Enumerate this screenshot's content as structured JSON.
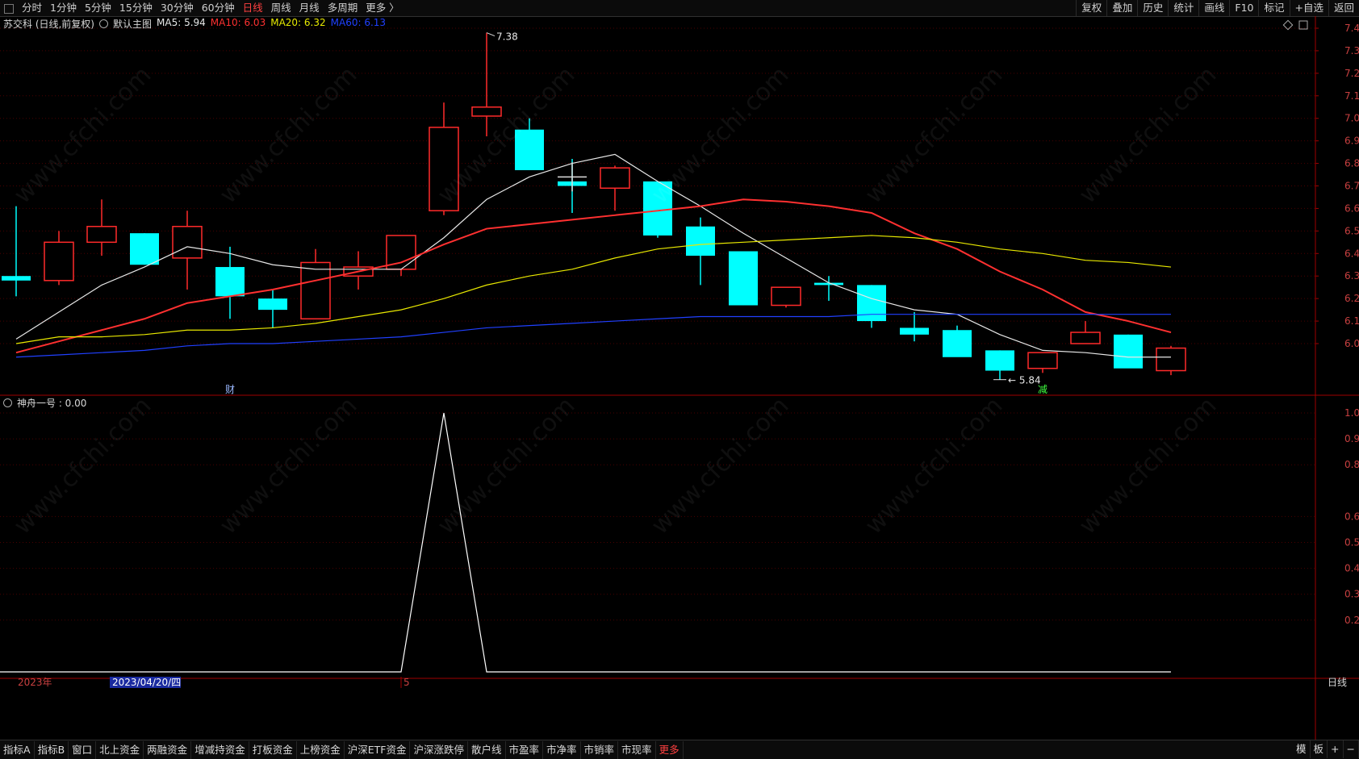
{
  "toolbar": {
    "periods": [
      {
        "label": "分时",
        "active": false
      },
      {
        "label": "1分钟",
        "active": false
      },
      {
        "label": "5分钟",
        "active": false
      },
      {
        "label": "15分钟",
        "active": false
      },
      {
        "label": "30分钟",
        "active": false
      },
      {
        "label": "60分钟",
        "active": false
      },
      {
        "label": "日线",
        "active": true
      },
      {
        "label": "周线",
        "active": false
      },
      {
        "label": "月线",
        "active": false
      },
      {
        "label": "多周期",
        "active": false
      },
      {
        "label": "更多 〉",
        "active": false
      }
    ],
    "right_buttons": [
      "复权",
      "叠加",
      "历史",
      "统计",
      "画线",
      "F10",
      "标记",
      "+自选",
      "返回"
    ]
  },
  "main_chart": {
    "stock_label": "苏交科 (日线,前复权)",
    "template_label": "默认主图",
    "ma_legend": [
      {
        "text": "MA5: 5.94",
        "color": "#e8e8e8"
      },
      {
        "text": "MA10: 6.03",
        "color": "#ff3030"
      },
      {
        "text": "MA20: 6.32",
        "color": "#e8e800"
      },
      {
        "text": "MA60: 6.13",
        "color": "#2040ff"
      }
    ],
    "y_axis_labels": [
      "7.40",
      "7.30",
      "7.20",
      "7.10",
      "7.00",
      "6.90",
      "6.80",
      "6.70",
      "6.60",
      "6.50",
      "6.40",
      "6.30",
      "6.20",
      "6.10",
      "6.00"
    ],
    "high_label": "7.38",
    "low_label": "5.84",
    "markers": [
      {
        "text": "财",
        "color": "#9ab8ff"
      },
      {
        "text": "减",
        "color": "#40ff40"
      }
    ]
  },
  "chart_data": [
    {
      "type": "candlestick",
      "title": "苏交科 (日线,前复权)",
      "ylim": [
        5.8,
        7.45
      ],
      "ohlc": [
        [
          6.3,
          6.61,
          6.21,
          6.28
        ],
        [
          6.28,
          6.5,
          6.26,
          6.45
        ],
        [
          6.45,
          6.64,
          6.39,
          6.52
        ],
        [
          6.49,
          6.49,
          6.35,
          6.35
        ],
        [
          6.38,
          6.59,
          6.24,
          6.52
        ],
        [
          6.34,
          6.43,
          6.11,
          6.21
        ],
        [
          6.2,
          6.24,
          6.07,
          6.15
        ],
        [
          6.11,
          6.42,
          6.11,
          6.36
        ],
        [
          6.3,
          6.41,
          6.24,
          6.34
        ],
        [
          6.33,
          6.48,
          6.3,
          6.48
        ],
        [
          6.59,
          7.07,
          6.57,
          6.96
        ],
        [
          7.01,
          7.38,
          6.92,
          7.05
        ],
        [
          6.95,
          7.0,
          6.77,
          6.77
        ],
        [
          6.72,
          6.82,
          6.58,
          6.7
        ],
        [
          6.69,
          6.79,
          6.59,
          6.78
        ],
        [
          6.72,
          6.72,
          6.47,
          6.48
        ],
        [
          6.52,
          6.56,
          6.26,
          6.39
        ],
        [
          6.41,
          6.41,
          6.17,
          6.17
        ],
        [
          6.17,
          6.25,
          6.16,
          6.25
        ],
        [
          6.27,
          6.3,
          6.19,
          6.26
        ],
        [
          6.26,
          6.26,
          6.07,
          6.1
        ],
        [
          6.07,
          6.14,
          6.01,
          6.04
        ],
        [
          6.06,
          6.08,
          5.95,
          5.94
        ],
        [
          5.97,
          5.97,
          5.84,
          5.88
        ],
        [
          5.89,
          5.96,
          5.87,
          5.96
        ],
        [
          6.0,
          6.1,
          6.0,
          6.05
        ],
        [
          6.04,
          6.04,
          5.91,
          5.89
        ],
        [
          5.88,
          5.99,
          5.86,
          5.98
        ]
      ],
      "series": [
        {
          "name": "MA5",
          "color": "#e8e8e8",
          "values": [
            6.02,
            6.14,
            6.26,
            6.34,
            6.43,
            6.4,
            6.35,
            6.33,
            6.33,
            6.33,
            6.47,
            6.64,
            6.74,
            6.8,
            6.84,
            6.72,
            6.61,
            6.49,
            6.38,
            6.27,
            6.2,
            6.15,
            6.13,
            6.04,
            5.97,
            5.96,
            5.94,
            5.94
          ]
        },
        {
          "name": "MA10",
          "color": "#ff3030",
          "values": [
            5.96,
            6.01,
            6.06,
            6.11,
            6.18,
            6.21,
            6.24,
            6.28,
            6.32,
            6.36,
            6.44,
            6.51,
            6.53,
            6.55,
            6.57,
            6.59,
            6.61,
            6.64,
            6.63,
            6.61,
            6.58,
            6.49,
            6.42,
            6.32,
            6.24,
            6.14,
            6.1,
            6.05
          ]
        },
        {
          "name": "MA20",
          "color": "#e8e800",
          "values": [
            6.0,
            6.03,
            6.03,
            6.04,
            6.06,
            6.06,
            6.07,
            6.09,
            6.12,
            6.15,
            6.2,
            6.26,
            6.3,
            6.33,
            6.38,
            6.42,
            6.44,
            6.45,
            6.46,
            6.47,
            6.48,
            6.47,
            6.45,
            6.42,
            6.4,
            6.37,
            6.36,
            6.34
          ]
        },
        {
          "name": "MA60",
          "color": "#2040ff",
          "values": [
            5.94,
            5.95,
            5.96,
            5.97,
            5.99,
            6.0,
            6.0,
            6.01,
            6.02,
            6.03,
            6.05,
            6.07,
            6.08,
            6.09,
            6.1,
            6.11,
            6.12,
            6.12,
            6.12,
            6.12,
            6.13,
            6.13,
            6.13,
            6.13,
            6.13,
            6.13,
            6.13,
            6.13
          ]
        }
      ]
    },
    {
      "type": "line",
      "title": "神舟一号 : 0.00",
      "ylim": [
        0,
        1.05
      ],
      "series": [
        {
          "name": "神舟一号",
          "color": "#ffffff",
          "values": [
            0,
            0,
            0,
            0,
            0,
            0,
            0,
            0,
            0,
            0,
            1,
            0,
            0,
            0,
            0,
            0,
            0,
            0,
            0,
            0,
            0,
            0,
            0,
            0,
            0,
            0,
            0,
            0
          ]
        }
      ]
    }
  ],
  "indicator": {
    "label": "神舟一号 : 0.00",
    "y_axis_labels": [
      "1.00",
      "0.90",
      "0.80",
      "0.60",
      "0.50",
      "0.40",
      "0.30",
      "0.20"
    ]
  },
  "date_axis": {
    "year_label": "2023年",
    "cursor_date": "2023/04/20/四",
    "month_mark": "5",
    "period_label": "日线"
  },
  "bottom_tabs": [
    {
      "label": "指标A",
      "active": false
    },
    {
      "label": "指标B",
      "active": false
    },
    {
      "label": "窗口",
      "active": false
    },
    {
      "label": "北上资金",
      "active": false
    },
    {
      "label": "两融资金",
      "active": false
    },
    {
      "label": "增减持资金",
      "active": false
    },
    {
      "label": "打板资金",
      "active": false
    },
    {
      "label": "上榜资金",
      "active": false
    },
    {
      "label": "沪深ETF资金",
      "active": false
    },
    {
      "label": "沪深涨跌停",
      "active": false
    },
    {
      "label": "散户线",
      "active": false
    },
    {
      "label": "市盈率",
      "active": false
    },
    {
      "label": "市净率",
      "active": false
    },
    {
      "label": "市销率",
      "active": false
    },
    {
      "label": "市现率",
      "active": false
    },
    {
      "label": "更多",
      "active": true
    }
  ],
  "bottom_right": [
    "模",
    "板",
    "+",
    "−"
  ],
  "colors": {
    "up": "#ff2a2a",
    "down": "#00ffff",
    "axis": "#a00000",
    "grid": "#4a0000"
  }
}
